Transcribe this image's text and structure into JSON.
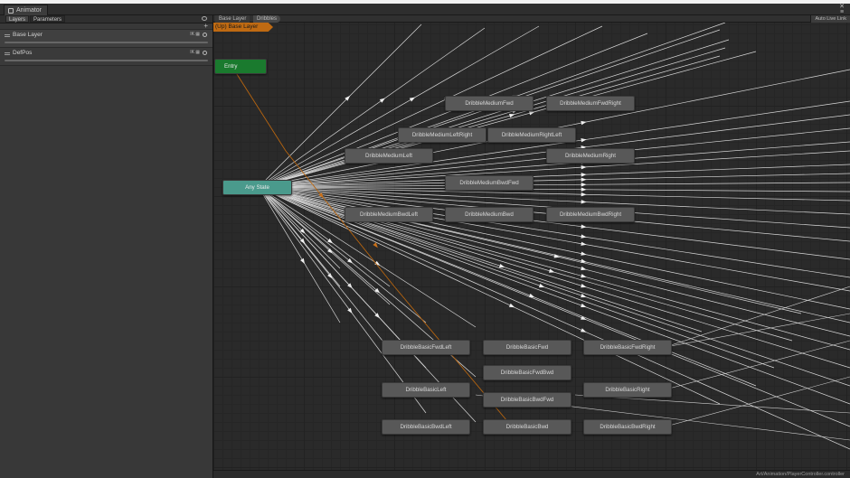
{
  "window": {
    "tab_title": "Animator"
  },
  "left_panel": {
    "tabs": [
      "Layers",
      "Parameters"
    ],
    "layers": [
      {
        "name": "Base Layer"
      },
      {
        "name": "DefPos"
      }
    ]
  },
  "graph": {
    "breadcrumbs": [
      "Base Layer",
      "Dribbles"
    ],
    "auto_live_link": "Auto Live Link",
    "layer_label": "(Up) Base Layer",
    "status_path": "Art/Animation/PlayerController.controller",
    "nodes": {
      "entry": "Entry",
      "any_state": "Any State",
      "medium_fwd": "DribbleMediumFwd",
      "medium_fwd_right": "DribbleMediumFwdRight",
      "medium_left_right": "DribbleMediumLeftRight",
      "medium_right_left": "DribbleMediumRightLeft",
      "medium_left": "DribbleMediumLeft",
      "medium_right": "DribbleMediumRight",
      "medium_bwd_fwd": "DribbleMediumBwdFwd",
      "medium_bwd_left": "DribbleMediumBwdLeft",
      "medium_bwd": "DribbleMediumBwd",
      "medium_bwd_right": "DribbleMediumBwdRight",
      "basic_fwd_left": "DribbleBasicFwdLeft",
      "basic_fwd": "DribbleBasicFwd",
      "basic_fwd_right": "DribbleBasicFwdRight",
      "basic_fwd_bwd": "DribbleBasicFwdBwd",
      "basic_left": "DribbleBasicLeft",
      "basic_right": "DribbleBasicRight",
      "basic_bwd_fwd": "DribbleBasicBwdFwd",
      "basic_bwd_left": "DribbleBasicBwdLeft",
      "basic_bwd": "DribbleBasicBwd",
      "basic_bwd_right": "DribbleBasicBwdRight"
    }
  }
}
